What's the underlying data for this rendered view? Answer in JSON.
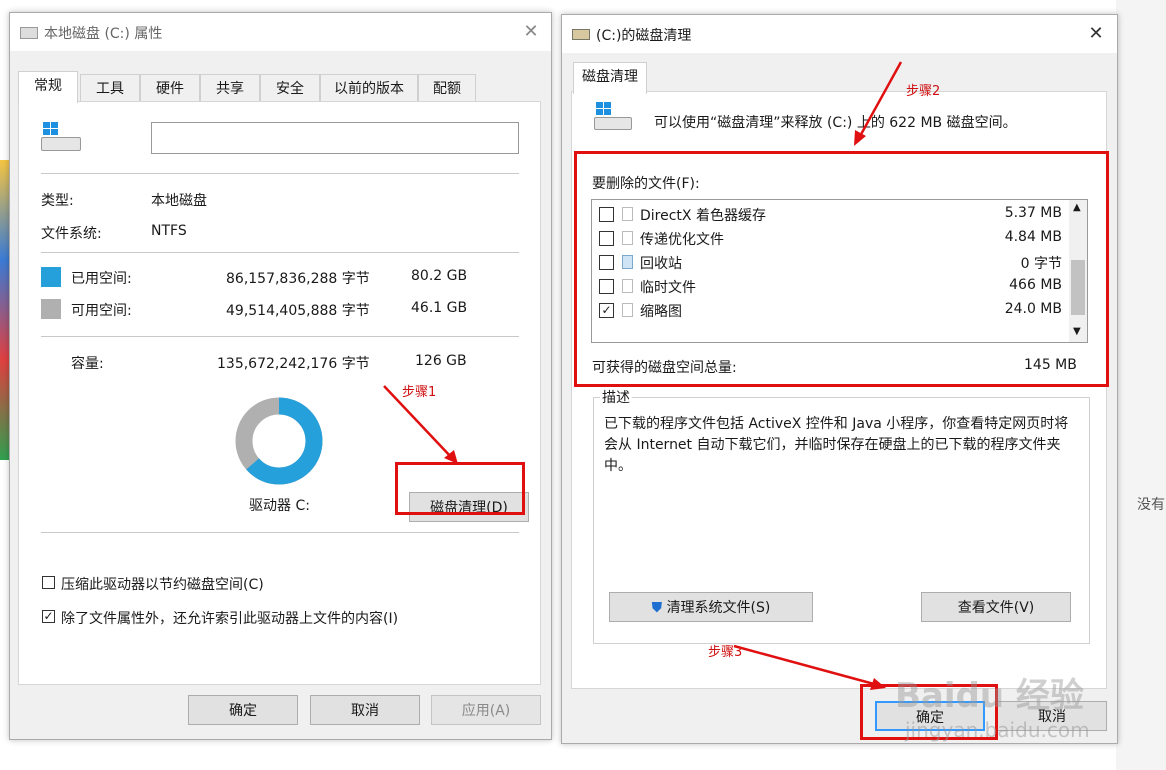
{
  "background": {
    "right_text": "没有"
  },
  "props_window": {
    "title": "本地磁盘 (C:) 属性",
    "tabs": [
      "常规",
      "工具",
      "硬件",
      "共享",
      "安全",
      "以前的版本",
      "配额"
    ],
    "label_input_value": "",
    "type_label": "类型:",
    "type_value": "本地磁盘",
    "fs_label": "文件系统:",
    "fs_value": "NTFS",
    "used_label": "已用空间:",
    "used_bytes": "86,157,836,288 字节",
    "used_gb": "80.2 GB",
    "free_label": "可用空间:",
    "free_bytes": "49,514,405,888 字节",
    "free_gb": "46.1 GB",
    "capacity_label": "容量:",
    "capacity_bytes": "135,672,242,176 字节",
    "capacity_gb": "126 GB",
    "used_fraction": 0.635,
    "drive_label": "驱动器 C:",
    "cleanup_button": "磁盘清理(D)",
    "compress_label": "压缩此驱动器以节约磁盘空间(C)",
    "compress_checked": false,
    "index_label": "除了文件属性外，还允许索引此驱动器上文件的内容(I)",
    "index_checked": true,
    "ok": "确定",
    "cancel": "取消",
    "apply": "应用(A)",
    "colors": {
      "used": "#26a0da",
      "free": "#b0b0b0"
    }
  },
  "cleanup_window": {
    "title": "(C:)的磁盘清理",
    "tab": "磁盘清理",
    "info": "可以使用“磁盘清理”来释放  (C:) 上的 622 MB 磁盘空间。",
    "files_label": "要删除的文件(F):",
    "files": [
      {
        "name": "DirectX 着色器缓存",
        "size": "5.37 MB",
        "checked": false,
        "icon": "file-icon"
      },
      {
        "name": "传递优化文件",
        "size": "4.84 MB",
        "checked": false,
        "icon": "file-icon"
      },
      {
        "name": "回收站",
        "size": "0 字节",
        "checked": false,
        "icon": "recycle-bin-icon"
      },
      {
        "name": "临时文件",
        "size": "466 MB",
        "checked": false,
        "icon": "file-icon"
      },
      {
        "name": "缩略图",
        "size": "24.0 MB",
        "checked": true,
        "icon": "file-icon"
      }
    ],
    "total_label": "可获得的磁盘空间总量:",
    "total_value": "145 MB",
    "desc_title": "描述",
    "desc_text": "已下载的程序文件包括 ActiveX 控件和 Java 小程序，你查看特定网页时将会从 Internet 自动下载它们，并临时保存在硬盘上的已下载的程序文件夹中。",
    "clean_system_button": "清理系统文件(S)",
    "view_files_button": "查看文件(V)",
    "ok": "确定",
    "cancel": "取消"
  },
  "annotations": {
    "step1": "步骤1",
    "step2": "步骤2",
    "step3": "步骤3"
  },
  "watermark": {
    "brand": "Baidu 经验",
    "url": "jingyan.baidu.com"
  }
}
